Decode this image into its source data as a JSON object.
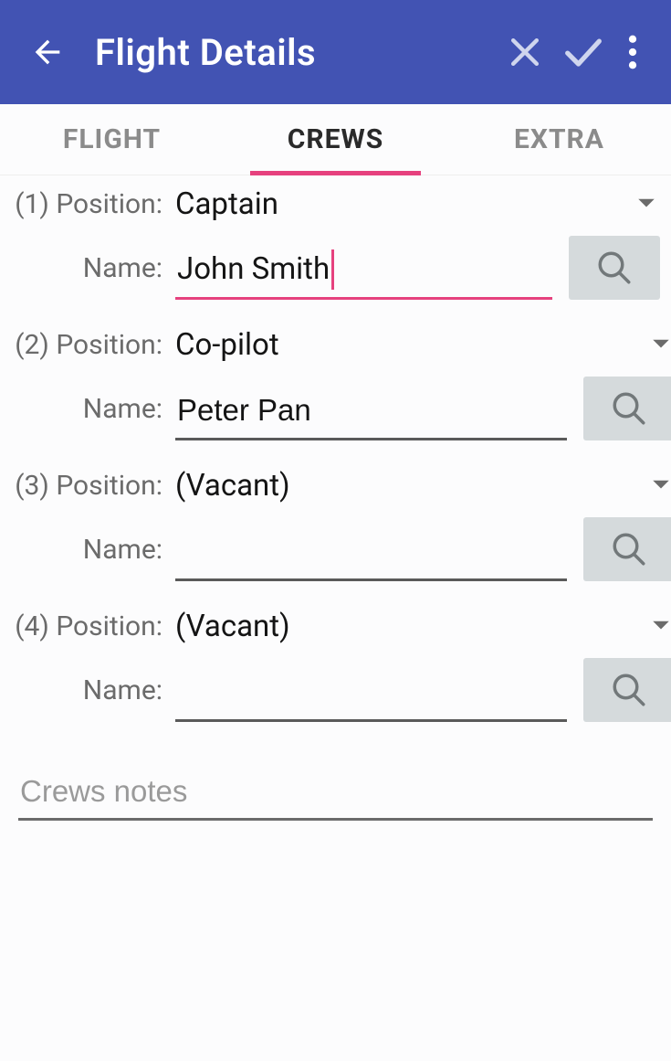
{
  "appbar": {
    "title": "Flight Details"
  },
  "tabs": [
    {
      "label": "FLIGHT",
      "active": false
    },
    {
      "label": "CREWS",
      "active": true
    },
    {
      "label": "EXTRA",
      "active": false
    }
  ],
  "field_labels": {
    "position": "Position:",
    "name": "Name:"
  },
  "crew": [
    {
      "index": "(1)",
      "position": "Captain",
      "name": "John Smith",
      "name_active": true
    },
    {
      "index": "(2)",
      "position": "Co-pilot",
      "name": "Peter Pan",
      "name_active": false
    },
    {
      "index": "(3)",
      "position": "(Vacant)",
      "name": "",
      "name_active": false
    },
    {
      "index": "(4)",
      "position": "(Vacant)",
      "name": "",
      "name_active": false
    }
  ],
  "notes": {
    "placeholder": "Crews notes",
    "value": ""
  },
  "colors": {
    "brand": "#4253b3",
    "accent": "#e6417e"
  }
}
